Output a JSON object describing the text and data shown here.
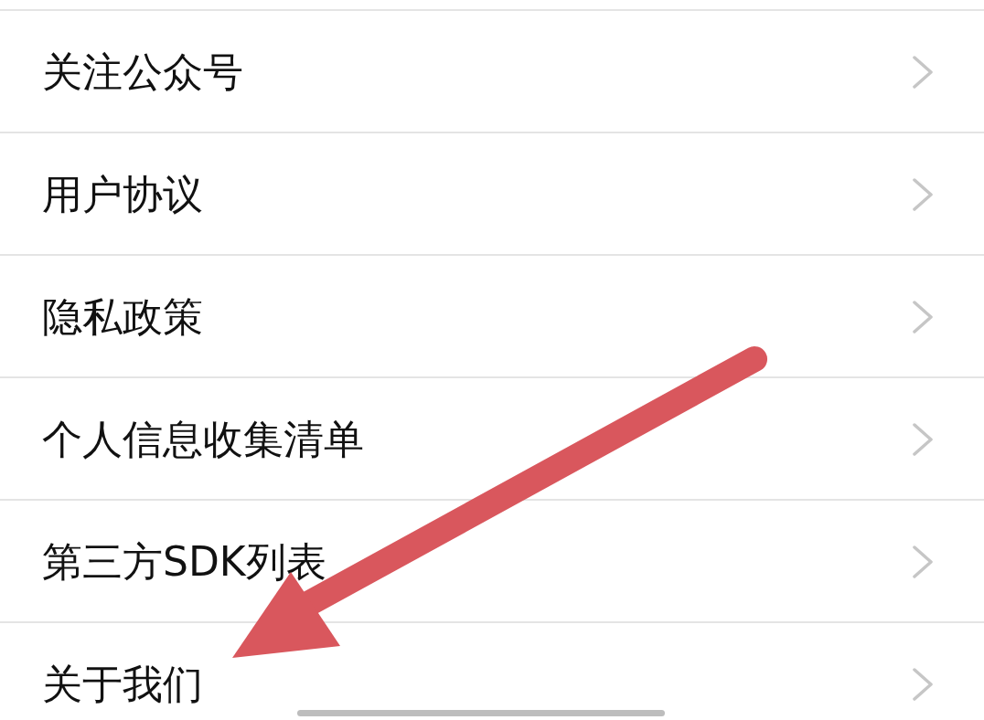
{
  "menu": {
    "items": [
      {
        "label": "关注公众号"
      },
      {
        "label": "用户协议"
      },
      {
        "label": "隐私政策"
      },
      {
        "label": "个人信息收集清单"
      },
      {
        "label": "第三方SDK列表"
      },
      {
        "label": "关于我们"
      }
    ]
  }
}
